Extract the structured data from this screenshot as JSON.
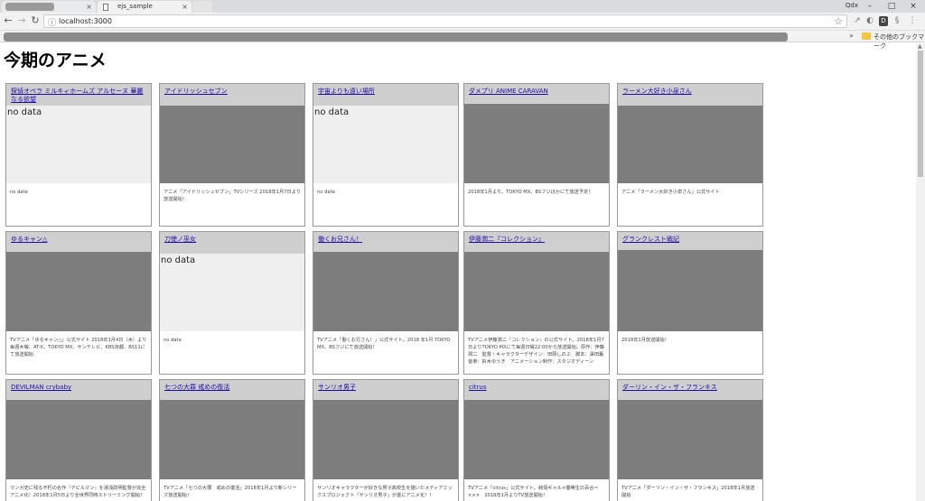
{
  "browser": {
    "tabs": [
      {
        "label": "",
        "close": "×"
      },
      {
        "label": "ejs_sample",
        "close": "×"
      }
    ],
    "profile": "Qdx",
    "window_controls": [
      "–",
      "□",
      "×"
    ],
    "url": "localhost:3000",
    "bookmarks_other": "その他のブックマーク",
    "bookmarks_more": "»"
  },
  "page": {
    "title": "今期のアニメ",
    "cards": [
      {
        "title": "探偵オペラ ミルキィホームズ アルセーヌ 華麗なる欲望",
        "has_image": false,
        "no_data": "no data",
        "desc": "no data"
      },
      {
        "title": "アイドリッシュセブン",
        "has_image": true,
        "desc": "アニメ「アイドリッシュセブン」TVシリーズ 2018年1月7日より放送開始！"
      },
      {
        "title": "宇宙よりも遠い場所",
        "has_image": false,
        "no_data": "no data",
        "desc": "no data"
      },
      {
        "title": "ダメプリ ANIME CARAVAN",
        "has_image": true,
        "desc": "2018年1月より、TOKYO MX、BSフジほかにて放送予定！"
      },
      {
        "title": "ラーメン大好き小泉さん",
        "has_image": true,
        "desc": "アニメ「ラーメン大好き小泉さん」公式サイト"
      },
      {
        "title": "ゆるキャン△",
        "has_image": true,
        "desc": "TVアニメ「ゆるキャン△」公式サイト 2018年1月4日（木）より毎週木曜、AT-X、TOKYO MX、サンテレビ、KBS京都、BS11にて放送開始"
      },
      {
        "title": "刀使ノ巫女",
        "has_image": false,
        "no_data": "no data",
        "desc": "no data"
      },
      {
        "title": "働くお兄さん！",
        "has_image": true,
        "desc": "TVアニメ「働くお兄さん！」公式サイト。2018 年1月 TOKYO MX、BSフジにて放送開始！"
      },
      {
        "title": "伊藤潤二『コレクション』",
        "has_image": true,
        "desc": "TVアニメ伊藤潤二『コレクション』の公式サイト。2018年1月7日よりTOKYO MXにて毎週日曜22:00から放送開始。原作：伊藤潤二　監督・キャラクターデザイン：田頭しのぶ　脚本：澤田薫　音楽：鈴木ゆうき　アニメーション制作：スタジオディーン"
      },
      {
        "title": "グランクレスト戦記",
        "has_image": true,
        "desc": "2018年1月放送開始！"
      },
      {
        "title": "DEVILMAN crybaby",
        "has_image": true,
        "desc": "マンガ史に残る不朽の名作『デビルマン』を湯浅政明監督が完全アニメ化！2018年1月5日より全世界同時ストリーミング開始！"
      },
      {
        "title": "七つの大罪 戒めの復活",
        "has_image": true,
        "desc": "TVアニメ「七つの大罪　戒めの復活」2018年1月より新シリーズ放送開始！"
      },
      {
        "title": "サンリオ男子",
        "has_image": true,
        "desc": "サンリオキャラクターが好きな男子高校生を描いたメディアミックスプロジェクト「サンリオ男子」が遂にアニメ化！！"
      },
      {
        "title": "citrus",
        "has_image": true,
        "desc": "TVアニメ「citrus」公式サイト。純情ギャル×優等生の百合＝×××　2018年1月よりTV放送開始！"
      },
      {
        "title": "ダーリン・イン・ザ・フランキス",
        "has_image": true,
        "desc": "TVアニメ「ダーリン・イン・ザ・フランキス」2018年1月放送開始"
      }
    ]
  }
}
